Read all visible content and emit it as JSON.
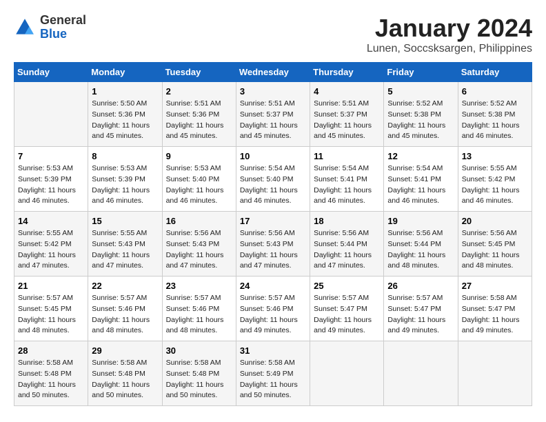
{
  "logo": {
    "general": "General",
    "blue": "Blue"
  },
  "title": "January 2024",
  "subtitle": "Lunen, Soccsksargen, Philippines",
  "days_header": [
    "Sunday",
    "Monday",
    "Tuesday",
    "Wednesday",
    "Thursday",
    "Friday",
    "Saturday"
  ],
  "weeks": [
    [
      {
        "day": "",
        "sunrise": "",
        "sunset": "",
        "daylight": ""
      },
      {
        "day": "1",
        "sunrise": "Sunrise: 5:50 AM",
        "sunset": "Sunset: 5:36 PM",
        "daylight": "Daylight: 11 hours and 45 minutes."
      },
      {
        "day": "2",
        "sunrise": "Sunrise: 5:51 AM",
        "sunset": "Sunset: 5:36 PM",
        "daylight": "Daylight: 11 hours and 45 minutes."
      },
      {
        "day": "3",
        "sunrise": "Sunrise: 5:51 AM",
        "sunset": "Sunset: 5:37 PM",
        "daylight": "Daylight: 11 hours and 45 minutes."
      },
      {
        "day": "4",
        "sunrise": "Sunrise: 5:51 AM",
        "sunset": "Sunset: 5:37 PM",
        "daylight": "Daylight: 11 hours and 45 minutes."
      },
      {
        "day": "5",
        "sunrise": "Sunrise: 5:52 AM",
        "sunset": "Sunset: 5:38 PM",
        "daylight": "Daylight: 11 hours and 45 minutes."
      },
      {
        "day": "6",
        "sunrise": "Sunrise: 5:52 AM",
        "sunset": "Sunset: 5:38 PM",
        "daylight": "Daylight: 11 hours and 46 minutes."
      }
    ],
    [
      {
        "day": "7",
        "sunrise": "Sunrise: 5:53 AM",
        "sunset": "Sunset: 5:39 PM",
        "daylight": "Daylight: 11 hours and 46 minutes."
      },
      {
        "day": "8",
        "sunrise": "Sunrise: 5:53 AM",
        "sunset": "Sunset: 5:39 PM",
        "daylight": "Daylight: 11 hours and 46 minutes."
      },
      {
        "day": "9",
        "sunrise": "Sunrise: 5:53 AM",
        "sunset": "Sunset: 5:40 PM",
        "daylight": "Daylight: 11 hours and 46 minutes."
      },
      {
        "day": "10",
        "sunrise": "Sunrise: 5:54 AM",
        "sunset": "Sunset: 5:40 PM",
        "daylight": "Daylight: 11 hours and 46 minutes."
      },
      {
        "day": "11",
        "sunrise": "Sunrise: 5:54 AM",
        "sunset": "Sunset: 5:41 PM",
        "daylight": "Daylight: 11 hours and 46 minutes."
      },
      {
        "day": "12",
        "sunrise": "Sunrise: 5:54 AM",
        "sunset": "Sunset: 5:41 PM",
        "daylight": "Daylight: 11 hours and 46 minutes."
      },
      {
        "day": "13",
        "sunrise": "Sunrise: 5:55 AM",
        "sunset": "Sunset: 5:42 PM",
        "daylight": "Daylight: 11 hours and 46 minutes."
      }
    ],
    [
      {
        "day": "14",
        "sunrise": "Sunrise: 5:55 AM",
        "sunset": "Sunset: 5:42 PM",
        "daylight": "Daylight: 11 hours and 47 minutes."
      },
      {
        "day": "15",
        "sunrise": "Sunrise: 5:55 AM",
        "sunset": "Sunset: 5:43 PM",
        "daylight": "Daylight: 11 hours and 47 minutes."
      },
      {
        "day": "16",
        "sunrise": "Sunrise: 5:56 AM",
        "sunset": "Sunset: 5:43 PM",
        "daylight": "Daylight: 11 hours and 47 minutes."
      },
      {
        "day": "17",
        "sunrise": "Sunrise: 5:56 AM",
        "sunset": "Sunset: 5:43 PM",
        "daylight": "Daylight: 11 hours and 47 minutes."
      },
      {
        "day": "18",
        "sunrise": "Sunrise: 5:56 AM",
        "sunset": "Sunset: 5:44 PM",
        "daylight": "Daylight: 11 hours and 47 minutes."
      },
      {
        "day": "19",
        "sunrise": "Sunrise: 5:56 AM",
        "sunset": "Sunset: 5:44 PM",
        "daylight": "Daylight: 11 hours and 48 minutes."
      },
      {
        "day": "20",
        "sunrise": "Sunrise: 5:56 AM",
        "sunset": "Sunset: 5:45 PM",
        "daylight": "Daylight: 11 hours and 48 minutes."
      }
    ],
    [
      {
        "day": "21",
        "sunrise": "Sunrise: 5:57 AM",
        "sunset": "Sunset: 5:45 PM",
        "daylight": "Daylight: 11 hours and 48 minutes."
      },
      {
        "day": "22",
        "sunrise": "Sunrise: 5:57 AM",
        "sunset": "Sunset: 5:46 PM",
        "daylight": "Daylight: 11 hours and 48 minutes."
      },
      {
        "day": "23",
        "sunrise": "Sunrise: 5:57 AM",
        "sunset": "Sunset: 5:46 PM",
        "daylight": "Daylight: 11 hours and 48 minutes."
      },
      {
        "day": "24",
        "sunrise": "Sunrise: 5:57 AM",
        "sunset": "Sunset: 5:46 PM",
        "daylight": "Daylight: 11 hours and 49 minutes."
      },
      {
        "day": "25",
        "sunrise": "Sunrise: 5:57 AM",
        "sunset": "Sunset: 5:47 PM",
        "daylight": "Daylight: 11 hours and 49 minutes."
      },
      {
        "day": "26",
        "sunrise": "Sunrise: 5:57 AM",
        "sunset": "Sunset: 5:47 PM",
        "daylight": "Daylight: 11 hours and 49 minutes."
      },
      {
        "day": "27",
        "sunrise": "Sunrise: 5:58 AM",
        "sunset": "Sunset: 5:47 PM",
        "daylight": "Daylight: 11 hours and 49 minutes."
      }
    ],
    [
      {
        "day": "28",
        "sunrise": "Sunrise: 5:58 AM",
        "sunset": "Sunset: 5:48 PM",
        "daylight": "Daylight: 11 hours and 50 minutes."
      },
      {
        "day": "29",
        "sunrise": "Sunrise: 5:58 AM",
        "sunset": "Sunset: 5:48 PM",
        "daylight": "Daylight: 11 hours and 50 minutes."
      },
      {
        "day": "30",
        "sunrise": "Sunrise: 5:58 AM",
        "sunset": "Sunset: 5:48 PM",
        "daylight": "Daylight: 11 hours and 50 minutes."
      },
      {
        "day": "31",
        "sunrise": "Sunrise: 5:58 AM",
        "sunset": "Sunset: 5:49 PM",
        "daylight": "Daylight: 11 hours and 50 minutes."
      },
      {
        "day": "",
        "sunrise": "",
        "sunset": "",
        "daylight": ""
      },
      {
        "day": "",
        "sunrise": "",
        "sunset": "",
        "daylight": ""
      },
      {
        "day": "",
        "sunrise": "",
        "sunset": "",
        "daylight": ""
      }
    ]
  ]
}
